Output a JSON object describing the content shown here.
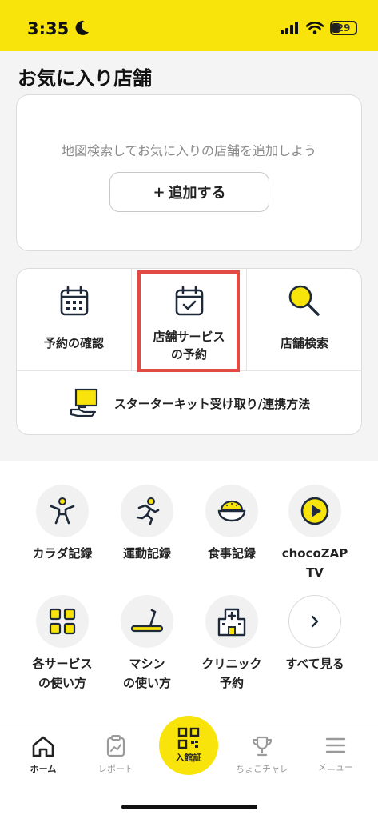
{
  "status_bar": {
    "time": "3:35",
    "battery": "29"
  },
  "favorites": {
    "title": "お気に入り店舗",
    "hint": "地図検索してお気に入りの店舗を追加しよう",
    "add_plus": "+",
    "add_label": "追加する"
  },
  "quick_menu": {
    "items": [
      {
        "label": "予約の確認",
        "icon": "calendar-grid-icon"
      },
      {
        "label": "店舗サービス\nの予約",
        "icon": "calendar-check-icon"
      },
      {
        "label": "店舗検索",
        "icon": "search-icon"
      }
    ],
    "starter": {
      "label": "スターターキット受け取り/連携方法",
      "icon": "hand-box-icon"
    }
  },
  "services": [
    {
      "label": "カラダ記録",
      "icon": "body-icon"
    },
    {
      "label": "運動記録",
      "icon": "running-icon"
    },
    {
      "label": "食事記録",
      "icon": "rice-bowl-icon"
    },
    {
      "label": "chocoZAP TV",
      "icon": "play-icon"
    },
    {
      "label": "各サービス\nの使い方",
      "icon": "grid-icon"
    },
    {
      "label": "マシン\nの使い方",
      "icon": "treadmill-icon"
    },
    {
      "label": "クリニック\n予約",
      "icon": "clinic-icon"
    },
    {
      "label": "すべて見る",
      "icon": "chevron-right-icon"
    }
  ],
  "tab_bar": {
    "home": "ホーム",
    "report": "レポート",
    "entry": "入館証",
    "challenge": "ちょこチャレ",
    "menu": "メニュー"
  },
  "colors": {
    "brand_yellow": "#f8e40a",
    "highlight_red": "#e14b44"
  }
}
